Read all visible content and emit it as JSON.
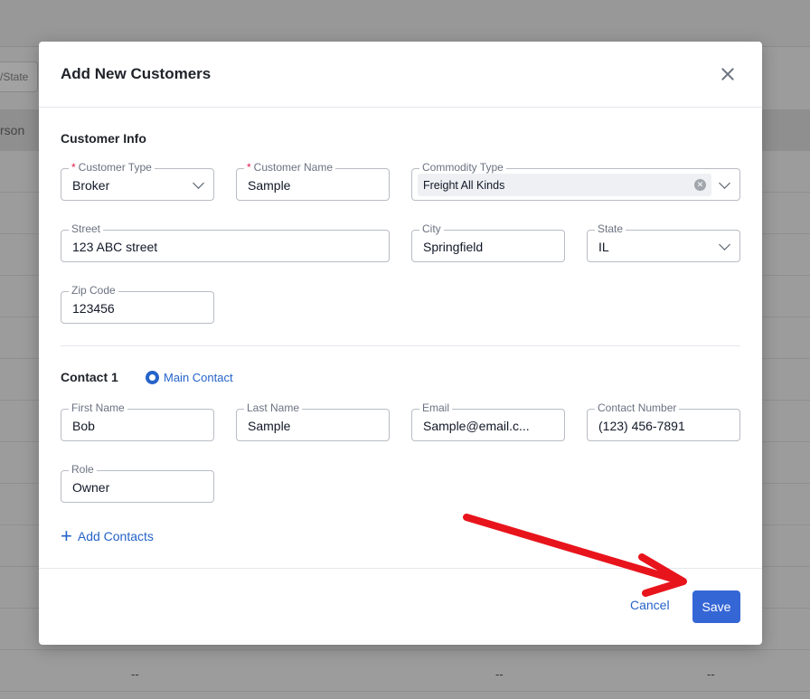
{
  "background": {
    "filter_label": "/State",
    "header_label": "rson",
    "dash": "--"
  },
  "modal": {
    "title": "Add New Customers",
    "customer_info": {
      "section_title": "Customer Info",
      "customer_type": {
        "label": "Customer Type",
        "value": "Broker"
      },
      "customer_name": {
        "label": "Customer Name",
        "value": "Sample"
      },
      "commodity_type": {
        "label": "Commodity Type",
        "value": "Freight All Kinds"
      },
      "street": {
        "label": "Street",
        "value": "123 ABC street"
      },
      "city": {
        "label": "City",
        "value": "Springfield"
      },
      "state": {
        "label": "State",
        "value": "IL"
      },
      "zip": {
        "label": "Zip Code",
        "value": "123456"
      }
    },
    "contact": {
      "section_title": "Contact 1",
      "main_contact_label": "Main Contact",
      "first_name": {
        "label": "First Name",
        "value": "Bob"
      },
      "last_name": {
        "label": "Last Name",
        "value": "Sample"
      },
      "email": {
        "label": "Email",
        "value": "Sample@email.c..."
      },
      "contact_number": {
        "label": "Contact Number",
        "value": "(123) 456-7891"
      },
      "role": {
        "label": "Role",
        "value": "Owner"
      }
    },
    "add_contacts_label": "Add Contacts",
    "cancel_label": "Cancel",
    "save_label": "Save",
    "required_marker": "*"
  },
  "colors": {
    "accent": "#3566d6",
    "annotation_arrow": "#e8141c"
  },
  "icons": [
    "close-icon",
    "chevron-down-icon",
    "clear-icon",
    "plus-icon",
    "radio-icon"
  ]
}
